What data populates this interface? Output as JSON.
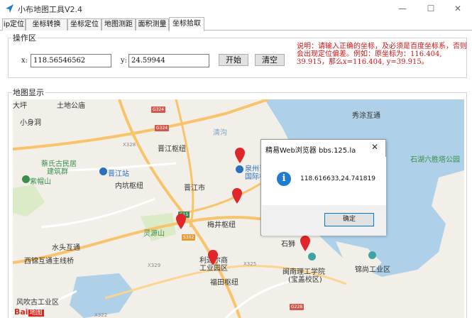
{
  "window": {
    "title": "小布地图工具V2.4",
    "controls": {
      "minimize": "—",
      "maximize": "☐",
      "close": "✕"
    }
  },
  "tabs": [
    {
      "label": "ip定位",
      "active": false
    },
    {
      "label": "坐标转换",
      "active": false
    },
    {
      "label": "坐标定位",
      "active": false
    },
    {
      "label": "地图测距",
      "active": false
    },
    {
      "label": "面积测量",
      "active": false
    },
    {
      "label": "坐标拾取",
      "active": true
    }
  ],
  "operation": {
    "title": "操作区",
    "x_label": "x:",
    "x_value": "118.56546562",
    "y_label": "y:",
    "y_value": "24.59944",
    "start_button": "开始",
    "clear_button": "清空",
    "note": "说明：请输入正确的坐标，及必须是百度坐标系，否则会出现定位偏差。例如：原坐标为：116.404, 39.915，那么x=116.404, y=39.915。"
  },
  "map": {
    "title": "地图显示",
    "logo_text": "Bai",
    "logo_badge": "地图",
    "labels": [
      {
        "text": "大坪",
        "cls": ""
      },
      {
        "text": "小身洞",
        "cls": ""
      },
      {
        "text": "土地公庙",
        "cls": ""
      },
      {
        "text": "紫帽山",
        "cls": "green"
      },
      {
        "text": "蔡氏古民居",
        "cls": "green"
      },
      {
        "text": "建筑群",
        "cls": "green"
      },
      {
        "text": "晋江站",
        "cls": "blue"
      },
      {
        "text": "内坑枢纽",
        "cls": ""
      },
      {
        "text": "晋江枢纽",
        "cls": ""
      },
      {
        "text": "晋江市",
        "cls": ""
      },
      {
        "text": "泉州晋江",
        "cls": "blue"
      },
      {
        "text": "国际机场",
        "cls": "blue"
      },
      {
        "text": "秀涂互通",
        "cls": ""
      },
      {
        "text": "石湖六胜塔公园",
        "cls": "green"
      },
      {
        "text": "灵源山",
        "cls": "green"
      },
      {
        "text": "梅井枢纽",
        "cls": ""
      },
      {
        "text": "水头互通",
        "cls": ""
      },
      {
        "text": "西锦互通主线桥",
        "cls": ""
      },
      {
        "text": "利达尔商",
        "cls": ""
      },
      {
        "text": "工业园区",
        "cls": ""
      },
      {
        "text": "福田枢纽",
        "cls": ""
      },
      {
        "text": "石狮",
        "cls": ""
      },
      {
        "text": "闽南理工学院",
        "cls": ""
      },
      {
        "text": "(宝盖校区)",
        "cls": ""
      },
      {
        "text": "锦尚工业区",
        "cls": ""
      },
      {
        "text": "风吹古工业区",
        "cls": ""
      },
      {
        "text": "清沟",
        "cls": "water"
      },
      {
        "text": "X328",
        "cls": "small"
      },
      {
        "text": "X329",
        "cls": "small"
      },
      {
        "text": "X325",
        "cls": "small"
      },
      {
        "text": "X322",
        "cls": "small"
      }
    ],
    "shields": [
      "G324",
      "G15",
      "G228",
      "G324",
      "S302"
    ]
  },
  "dialog": {
    "title": "精易Web浏览器 bbs.125.la",
    "close": "✕",
    "icon": "i",
    "message": "118.616633,24.741819",
    "ok_button": "确定"
  },
  "colors": {
    "accent_tab": "#ffffff",
    "note_red": "#d01515",
    "pin_red": "#e0262b",
    "dialog_icon": "#1f7ccf",
    "sea": "#aed0e8",
    "highway": "#f8c36a"
  }
}
